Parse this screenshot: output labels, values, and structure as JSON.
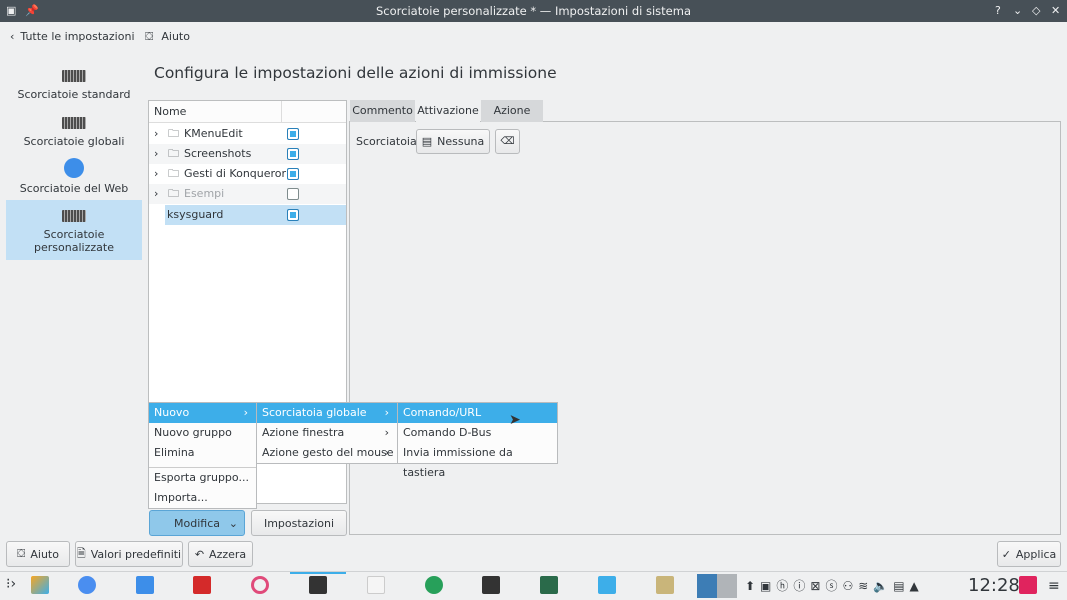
{
  "window": {
    "title": "Scorciatoie personalizzate * — Impostazioni di sistema",
    "controls": [
      "?",
      "⌄",
      "◇",
      "✕"
    ]
  },
  "toolbar": {
    "back": "Tutte le impostazioni",
    "help": "Aiuto"
  },
  "sidebar": {
    "items": [
      {
        "label": "Scorciatoie standard"
      },
      {
        "label": "Scorciatoie globali"
      },
      {
        "label": "Scorciatoie del Web"
      },
      {
        "label": "Scorciatoie personalizzate"
      }
    ]
  },
  "page": {
    "title": "Configura le impostazioni delle azioni di immissione"
  },
  "tree": {
    "header": "Nome",
    "rows": [
      {
        "label": "KMenuEdit",
        "checked": true
      },
      {
        "label": "Screenshots",
        "checked": true
      },
      {
        "label": "Gesti di Konqueror",
        "checked": true
      },
      {
        "label": "Esempi",
        "checked": false
      },
      {
        "label": "ksysguard",
        "checked": true
      }
    ]
  },
  "tabs": [
    {
      "label": "Commento"
    },
    {
      "label": "Attivazione"
    },
    {
      "label": "Azione"
    }
  ],
  "shortcut": {
    "label": "Scorciatoia:",
    "value": "Nessuna"
  },
  "menu1": [
    "Nuovo",
    "Nuovo gruppo",
    "Elimina",
    "Esporta gruppo...",
    "Importa..."
  ],
  "menu2": [
    "Scorciatoia globale",
    "Azione finestra",
    "Azione gesto del mouse"
  ],
  "menu3": [
    "Comando/URL",
    "Comando D-Bus",
    "Invia immissione da tastiera"
  ],
  "buttons": {
    "modifica": "Modifica",
    "impostazioni": "Impostazioni",
    "aiuto": "Aiuto",
    "predefiniti": "Valori predefiniti",
    "azzera": "Azzera",
    "applica": "Applica"
  },
  "taskbar": {
    "clock": "12:28"
  }
}
